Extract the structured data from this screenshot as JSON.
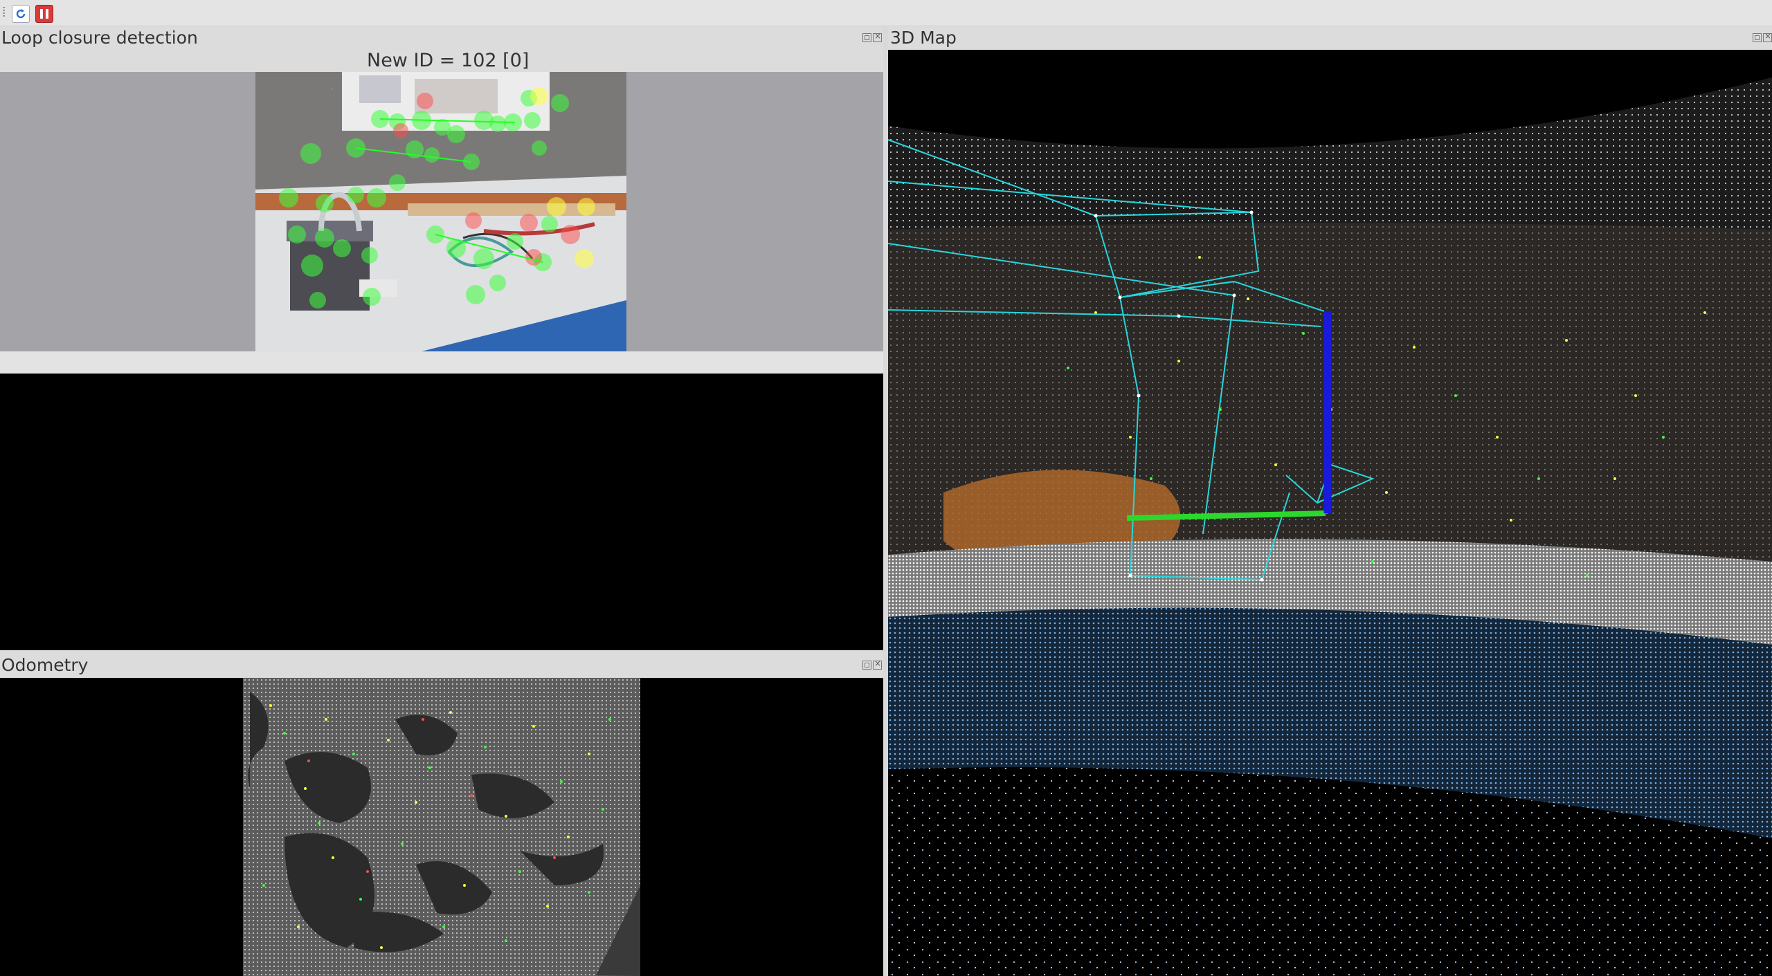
{
  "toolbar": {
    "refresh_icon": "refresh-icon",
    "pause_icon": "pause-icon"
  },
  "panels": {
    "loop_closure": {
      "title": "Loop closure detection",
      "new_id_text": "New ID = 102 [0]"
    },
    "map": {
      "title": "3D Map"
    },
    "odometry": {
      "title": "Odometry"
    }
  },
  "colors": {
    "feature_green": "#3cff3c",
    "feature_red": "#ff4a4a",
    "feature_yellow": "#ffff3c",
    "trajectory": "#27d6dc",
    "axis_x": "#2cd82c",
    "axis_z": "#1a1add",
    "floor_points": "#6fa6d8"
  }
}
